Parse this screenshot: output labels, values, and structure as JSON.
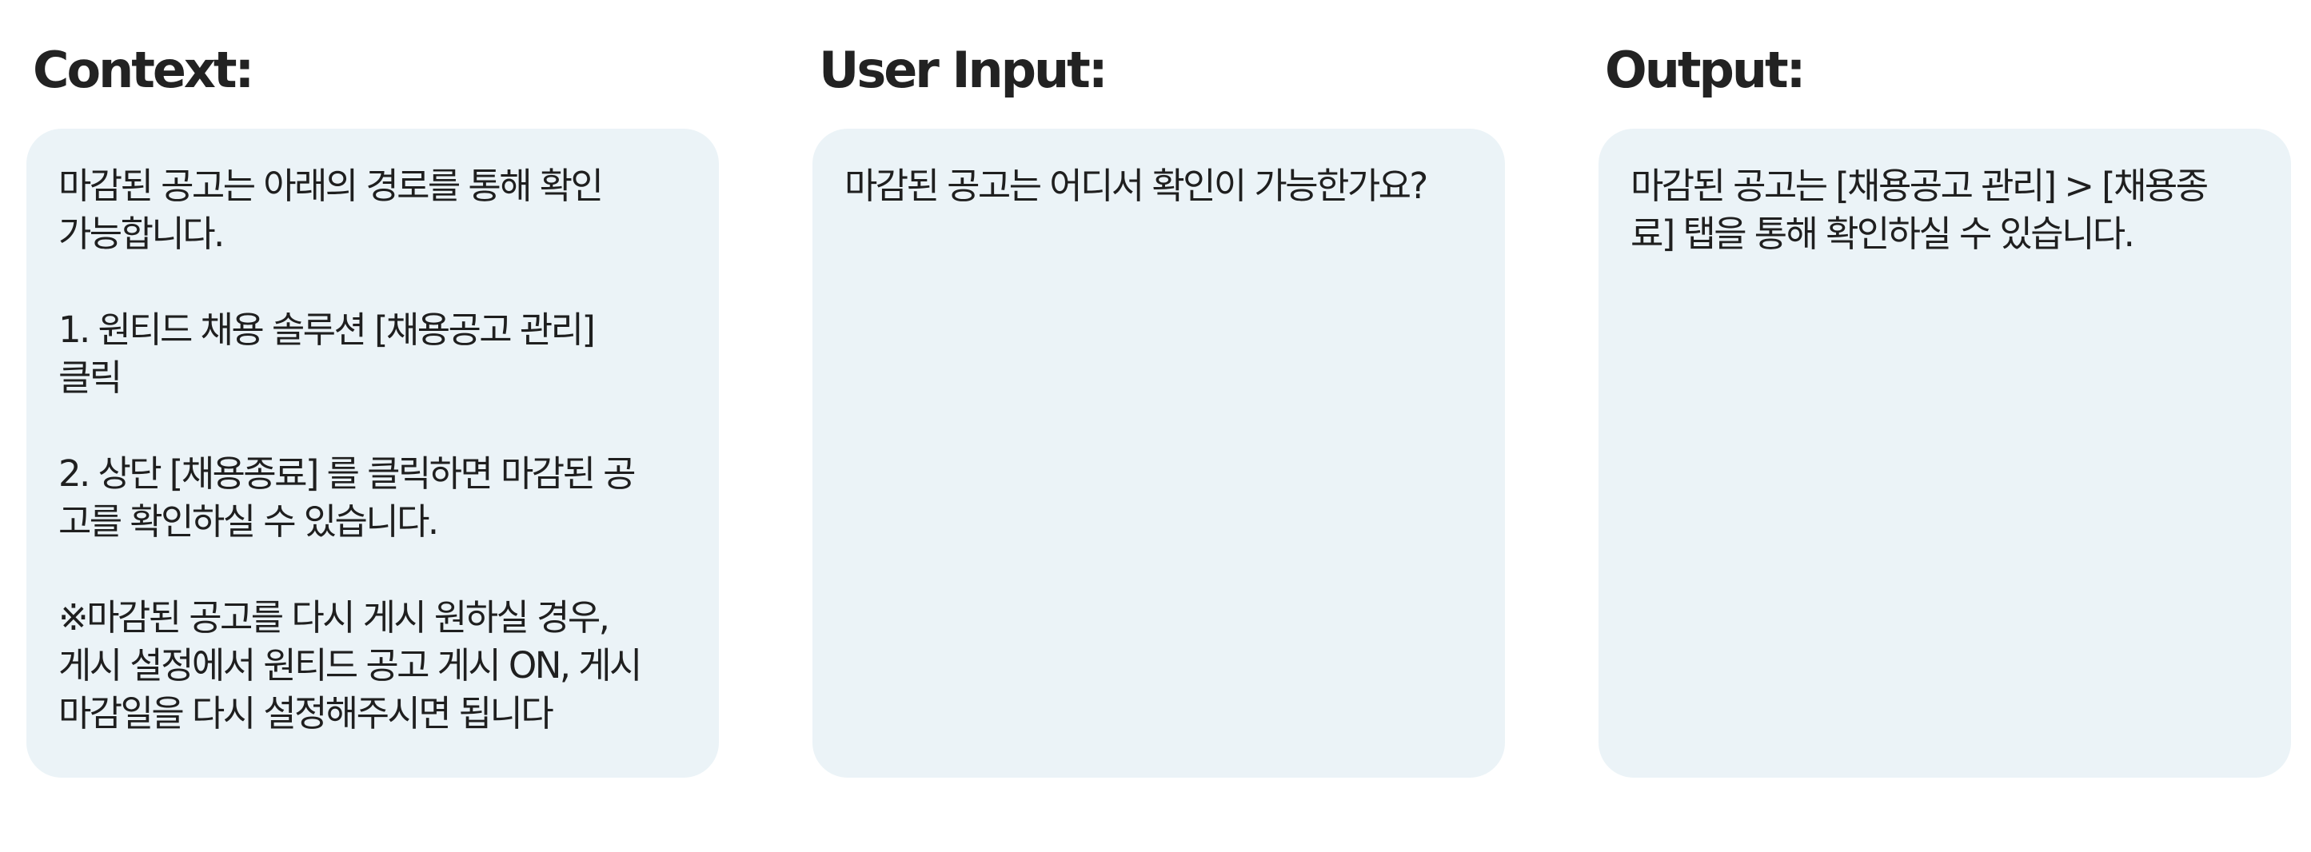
{
  "panels": {
    "context": {
      "heading": "Context:",
      "text": "마감된 공고는 아래의 경로를 통해 확인\n가능합니다.\n\n1. 원티드 채용 솔루션 [채용공고 관리]\n클릭\n\n2. 상단 [채용종료] 를 클릭하면 마감된 공\n고를 확인하실 수 있습니다.\n\n※마감된 공고를 다시 게시 원하실 경우,\n게시 설정에서 원티드 공고 게시 ON, 게시\n마감일을 다시 설정해주시면 됩니다"
    },
    "user_input": {
      "heading": "User Input:",
      "text": "마감된 공고는 어디서 확인이 가능한가요?"
    },
    "output": {
      "heading": "Output:",
      "text": "마감된 공고는 [채용공고 관리] > [채용종\n료] 탭을 통해 확인하실 수 있습니다."
    }
  },
  "colors": {
    "card_background": "#ebf3f7",
    "text": "#1f1f1f",
    "page_background": "#ffffff"
  }
}
